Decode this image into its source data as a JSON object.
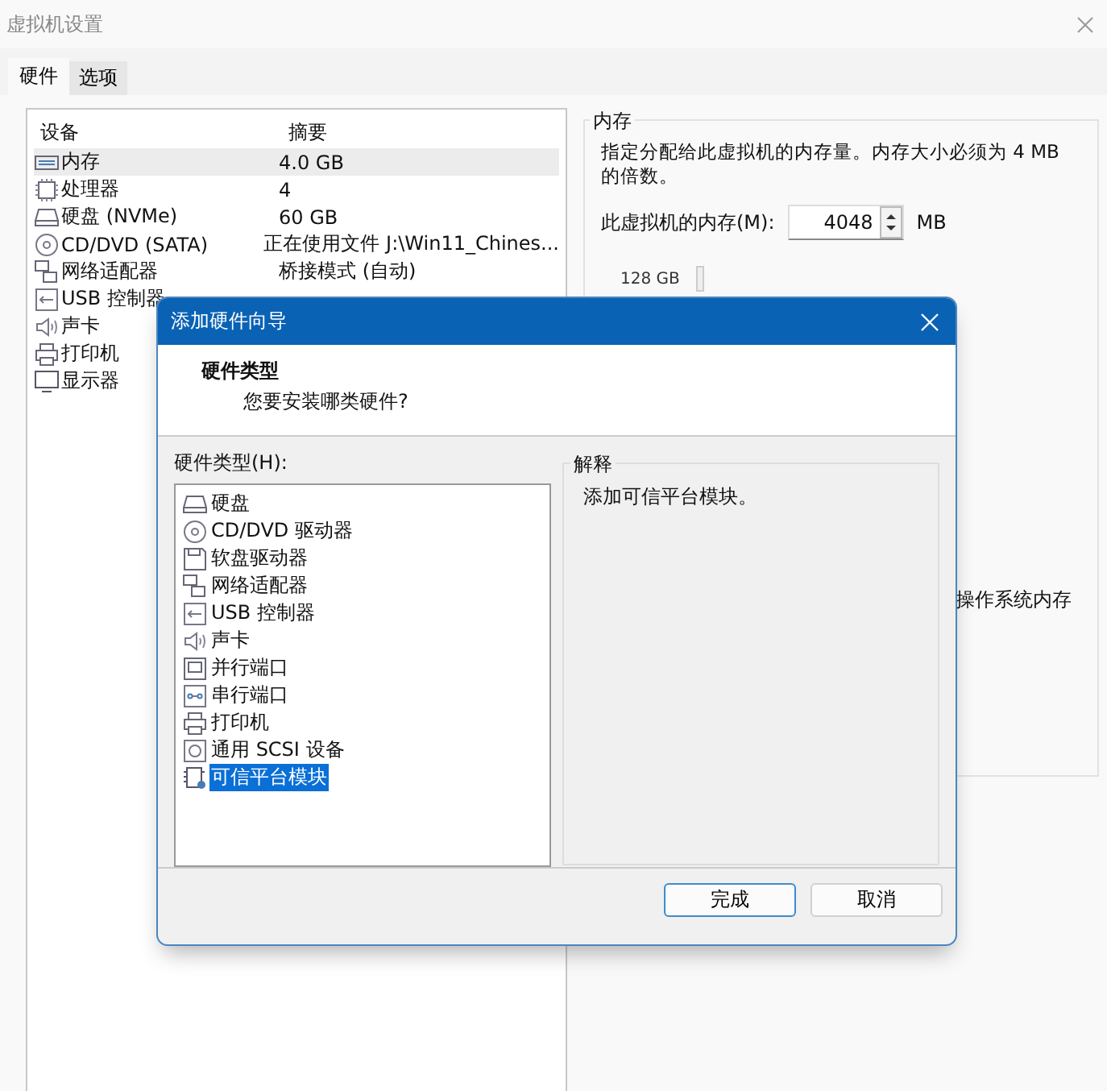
{
  "window": {
    "title": "虚拟机设置"
  },
  "tabs": [
    {
      "label": "硬件",
      "selected": true
    },
    {
      "label": "选项",
      "selected": false
    }
  ],
  "device_table": {
    "columns": [
      "设备",
      "摘要"
    ],
    "rows": [
      {
        "kind": "memory",
        "device": "内存",
        "summary": "4.0 GB",
        "selected": true
      },
      {
        "kind": "cpu",
        "device": "处理器",
        "summary": "4",
        "selected": false
      },
      {
        "kind": "disk",
        "device": "硬盘 (NVMe)",
        "summary": "60 GB",
        "selected": false
      },
      {
        "kind": "disc",
        "device": "CD/DVD (SATA)",
        "summary": "正在使用文件 J:\\Win11_Chines...",
        "selected": false
      },
      {
        "kind": "network",
        "device": "网络适配器",
        "summary": "桥接模式 (自动)",
        "selected": false
      },
      {
        "kind": "usb",
        "device": "USB 控制器",
        "selected": false
      },
      {
        "kind": "sound",
        "device": "声卡",
        "selected": false
      },
      {
        "kind": "printer",
        "device": "打印机",
        "selected": false
      },
      {
        "kind": "display",
        "device": "显示器",
        "selected": false
      }
    ]
  },
  "memory_panel": {
    "title": "内存",
    "description": "指定分配给此虚拟机的内存量。内存大小必须为 4 MB 的倍数。",
    "field_label": "此虚拟机的内存(M):",
    "value": "4048",
    "unit": "MB",
    "scale_label": "128 GB",
    "note": "操作系统内存"
  },
  "dialog": {
    "title": "添加硬件向导",
    "heading": "硬件类型",
    "subheading": "您要安装哪类硬件?",
    "list_label": "硬件类型(H):",
    "items": [
      {
        "kind": "disk",
        "label": "硬盘",
        "selected": false
      },
      {
        "kind": "disc",
        "label": "CD/DVD 驱动器",
        "selected": false
      },
      {
        "kind": "floppy",
        "label": "软盘驱动器",
        "selected": false
      },
      {
        "kind": "network",
        "label": "网络适配器",
        "selected": false
      },
      {
        "kind": "usb",
        "label": "USB 控制器",
        "selected": false
      },
      {
        "kind": "sound",
        "label": "声卡",
        "selected": false
      },
      {
        "kind": "parallel",
        "label": "并行端口",
        "selected": false
      },
      {
        "kind": "serial",
        "label": "串行端口",
        "selected": false
      },
      {
        "kind": "printer",
        "label": "打印机",
        "selected": false
      },
      {
        "kind": "scsi",
        "label": "通用 SCSI 设备",
        "selected": false
      },
      {
        "kind": "tpm",
        "label": "可信平台模块",
        "selected": true
      }
    ],
    "explanation_title": "解释",
    "explanation": "添加可信平台模块。",
    "buttons": [
      {
        "label": "完成",
        "default": true
      },
      {
        "label": "取消",
        "default": false
      }
    ]
  }
}
